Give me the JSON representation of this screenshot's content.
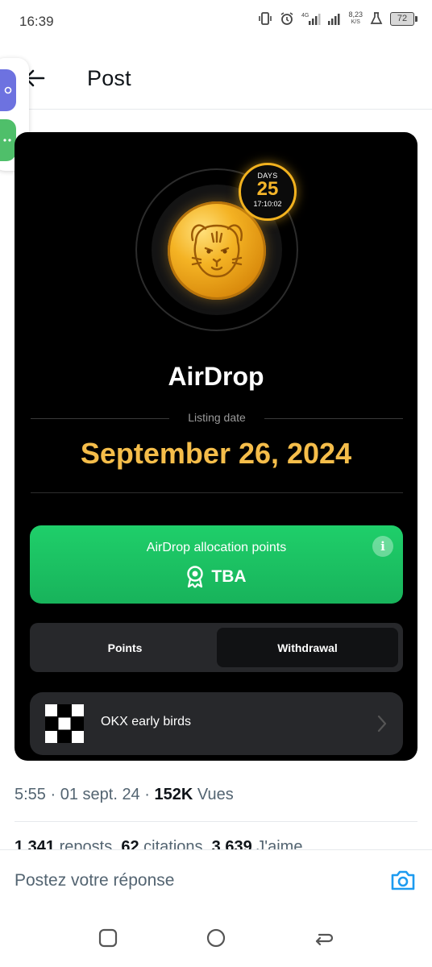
{
  "status_bar": {
    "time": "16:39",
    "net_speed_value": "8,23",
    "net_speed_unit": "K/S",
    "network_type": "4G",
    "battery": "72"
  },
  "header": {
    "title": "Post"
  },
  "media": {
    "days_label": "DAYS",
    "days_value": "25",
    "countdown": "17:10:02",
    "title": "AirDrop",
    "listing_label": "Listing date",
    "listing_date": "September 26, 2024",
    "allocation_label": "AirDrop allocation points",
    "allocation_value": "TBA",
    "tabs": [
      {
        "label": "Points",
        "active": false
      },
      {
        "label": "Withdrawal",
        "active": true
      }
    ],
    "okx_label": "OKX early birds",
    "colors": {
      "accent_gold": "#f5bd4a",
      "allocation_green": "#1fcf6a"
    }
  },
  "tweet": {
    "time": "5:55",
    "date": "01 sept. 24",
    "views_count": "152K",
    "views_label": "Vues",
    "reposts_count": "1 341",
    "reposts_label": "reposts",
    "quotes_count": "62",
    "quotes_label": "citations",
    "likes_count": "3 639",
    "likes_label": "J'aime"
  },
  "reply": {
    "placeholder": "Postez votre réponse",
    "accent": "#1d9bf0"
  }
}
